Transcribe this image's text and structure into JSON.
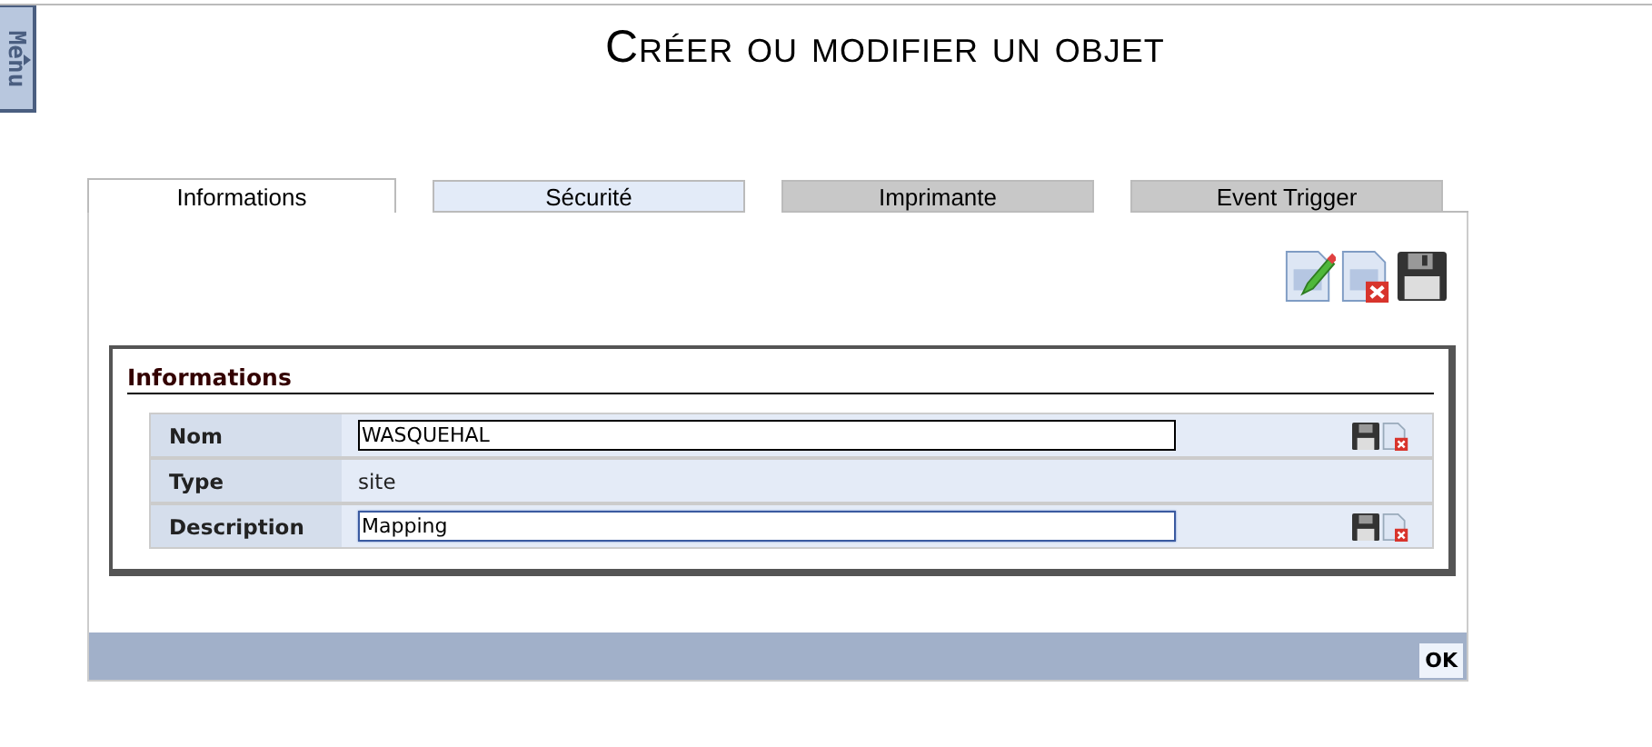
{
  "menu_tab": {
    "label": "Menu"
  },
  "page_title": "Créer ou modifier un objet",
  "tabs": [
    {
      "label": "Informations",
      "selected": true,
      "disabled": false
    },
    {
      "label": "Sécurité",
      "selected": false,
      "disabled": false
    },
    {
      "label": "Imprimante",
      "selected": false,
      "disabled": true
    },
    {
      "label": "Event Trigger",
      "selected": false,
      "disabled": true
    }
  ],
  "toolbar": [
    {
      "kind": "edit"
    },
    {
      "kind": "delete"
    },
    {
      "kind": "save"
    }
  ],
  "section": {
    "title": "Informations",
    "rows": [
      {
        "label": "Nom",
        "kind": "input",
        "value": "WASQUEHAL",
        "focused": false
      },
      {
        "label": "Type",
        "kind": "text",
        "value": "site"
      },
      {
        "label": "Description",
        "kind": "input",
        "value": "Mapping",
        "focused": true
      }
    ]
  },
  "footer": {
    "button": "OK"
  }
}
